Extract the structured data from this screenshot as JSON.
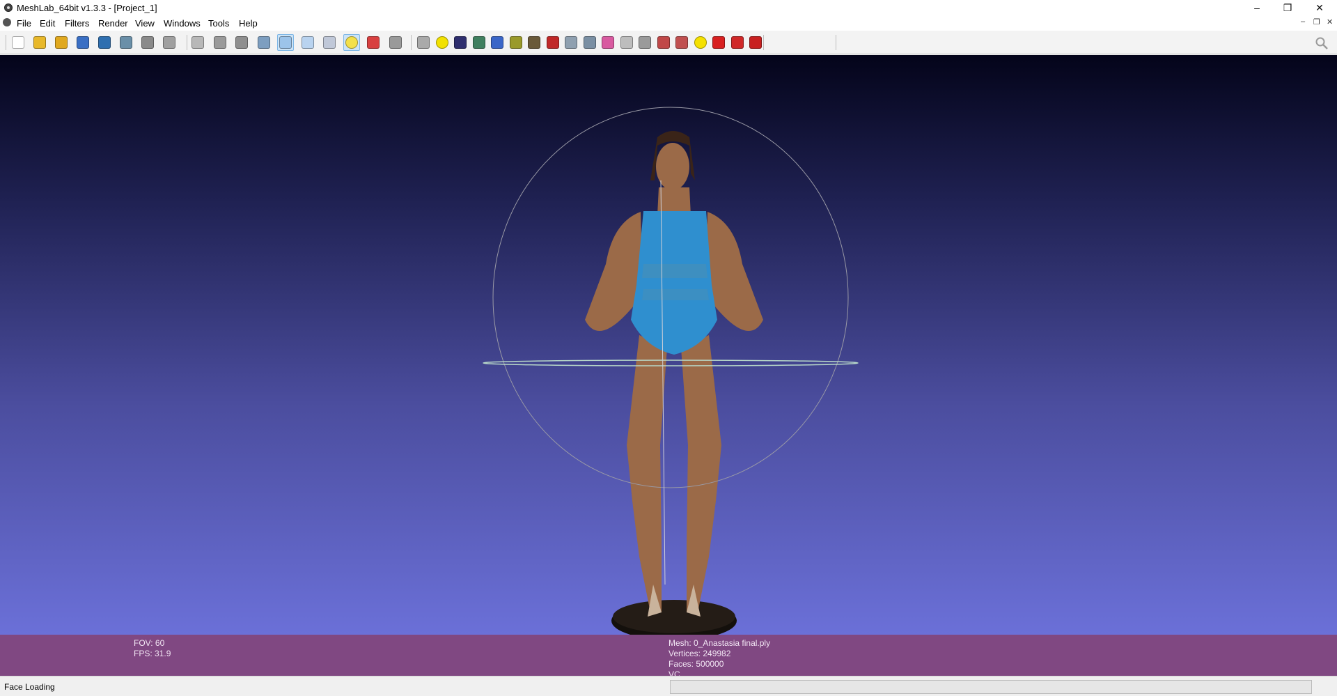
{
  "window": {
    "title": "MeshLab_64bit v1.3.3 - [Project_1]",
    "controls": {
      "minimize": "–",
      "restore": "❐",
      "close": "✕"
    }
  },
  "menu": {
    "items": [
      "File",
      "Edit",
      "Filters",
      "Render",
      "View",
      "Windows",
      "Tools",
      "Help"
    ],
    "mdi_controls": {
      "minimize": "–",
      "restore": "❐",
      "close": "✕"
    }
  },
  "toolbar": {
    "tools": [
      {
        "name": "new-project-icon",
        "color": "#ffffff",
        "active": false
      },
      {
        "name": "open-project-icon",
        "color": "#e8b82a",
        "active": false
      },
      {
        "name": "import-mesh-icon",
        "color": "#e0a81e",
        "active": false
      },
      {
        "name": "reload-icon",
        "color": "#3a6fc4",
        "active": false
      },
      {
        "name": "export-mesh-icon",
        "color": "#2f6fb0",
        "active": false
      },
      {
        "name": "snapshot-icon",
        "color": "#6a8fa8",
        "active": false
      },
      {
        "name": "layers-icon",
        "color": "#8a8a8a",
        "active": false
      },
      {
        "name": "raster-icon",
        "color": "#a0a0a0",
        "active": false
      },
      {
        "name": "bounding-box-icon",
        "color": "#b8b8b8",
        "active": false
      },
      {
        "name": "points-icon",
        "color": "#9a9a9a",
        "active": false
      },
      {
        "name": "wireframe-icon",
        "color": "#8f8f8f",
        "active": false
      },
      {
        "name": "flat-lines-icon",
        "color": "#7d9ec0",
        "active": false
      },
      {
        "name": "flat-shading-icon",
        "color": "#9cc4ea",
        "active": true
      },
      {
        "name": "smooth-shading-icon",
        "color": "#b9d3ef",
        "active": false
      },
      {
        "name": "texture-icon",
        "color": "#c0c8d8",
        "active": false
      },
      {
        "name": "light-bulb-icon",
        "color": "#f3e04a",
        "active": true
      },
      {
        "name": "fancy-lighting-icon",
        "color": "#d84040",
        "active": false
      },
      {
        "name": "back-face-icon",
        "color": "#9a9a9a",
        "active": false
      },
      {
        "name": "trackball-icon",
        "color": "#aaaaaa",
        "active": false
      },
      {
        "name": "annotation-icon",
        "color": "#f2e100",
        "active": false
      },
      {
        "name": "shader-icon",
        "color": "#2e2e6e",
        "active": false
      },
      {
        "name": "texture-map-icon",
        "color": "#3f7f5f",
        "active": false
      },
      {
        "name": "align-icon",
        "color": "#3a66c8",
        "active": false
      },
      {
        "name": "measure-icon",
        "color": "#9a9a2a",
        "active": false
      },
      {
        "name": "paint-brush-icon",
        "color": "#6a5a3a",
        "active": false
      },
      {
        "name": "pick-points-icon",
        "color": "#c02828",
        "active": false
      },
      {
        "name": "select-vertices-icon",
        "color": "#8fa0b0",
        "active": false
      },
      {
        "name": "select-faces-icon",
        "color": "#7a8fa3",
        "active": false
      },
      {
        "name": "color-paint-icon",
        "color": "#d85aa0",
        "active": false
      },
      {
        "name": "reference-icon",
        "color": "#bdbdbd",
        "active": false
      },
      {
        "name": "select-rect-icon",
        "color": "#9a9a9a",
        "active": false
      },
      {
        "name": "quality-select-icon",
        "color": "#c04848",
        "active": false
      },
      {
        "name": "connected-select-icon",
        "color": "#c05050",
        "active": false
      },
      {
        "name": "info-icon",
        "color": "#f5e100",
        "active": false
      },
      {
        "name": "delete-selected-icon",
        "color": "#d82020",
        "active": false
      },
      {
        "name": "delete-vertices-icon",
        "color": "#d02828",
        "active": false
      },
      {
        "name": "delete-faces-icon",
        "color": "#c82020",
        "active": false
      }
    ],
    "search_icon": "search-icon"
  },
  "viewport": {
    "bg_top": "#04041a",
    "bg_bottom": "#6b70d8",
    "swimsuit_color": "#2f8fcf",
    "skin_color": "#9b6a48",
    "base_color": "#14100c"
  },
  "info": {
    "fov": "FOV: 60",
    "fps": "FPS:    31.9",
    "mesh": "Mesh: 0_Anastasia final.ply",
    "vertices": "Vertices: 249982",
    "faces": "Faces: 500000",
    "vc": "VC"
  },
  "status": {
    "message": "Face Loading"
  }
}
